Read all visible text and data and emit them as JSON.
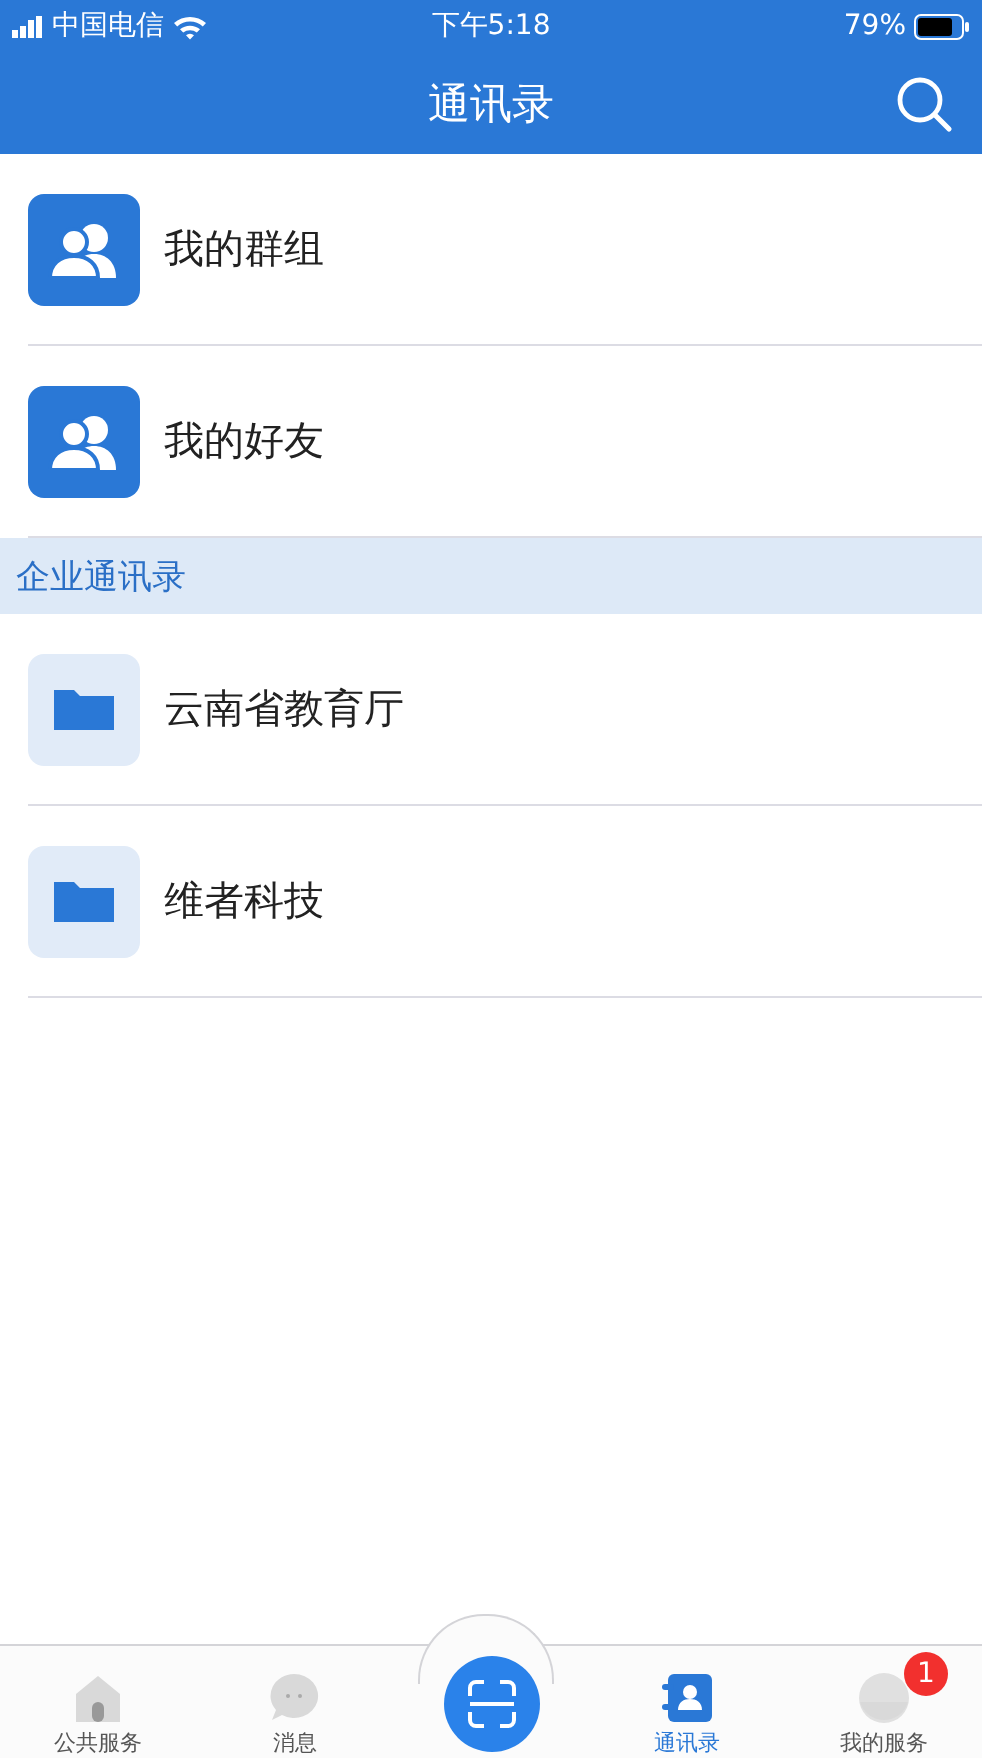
{
  "status_bar": {
    "carrier": "中国电信",
    "time": "下午5:18",
    "battery": "79%"
  },
  "header": {
    "title": "通讯录"
  },
  "quick_items": [
    {
      "kind": "group",
      "label": "我的群组"
    },
    {
      "kind": "group",
      "label": "我的好友"
    }
  ],
  "section": {
    "title": "企业通讯录"
  },
  "organizations": [
    {
      "kind": "folder",
      "label": "云南省教育厅"
    },
    {
      "kind": "folder",
      "label": "维者科技"
    }
  ],
  "tab_bar": [
    {
      "kind": "home",
      "label": "公共服务",
      "selected": false
    },
    {
      "kind": "chat",
      "label": "消息",
      "selected": false
    },
    {
      "kind": "scan",
      "selected": false
    },
    {
      "kind": "contacts",
      "label": "通讯录",
      "selected": true
    },
    {
      "kind": "profile",
      "label": "我的服务",
      "selected": false,
      "badge": "1"
    }
  ]
}
